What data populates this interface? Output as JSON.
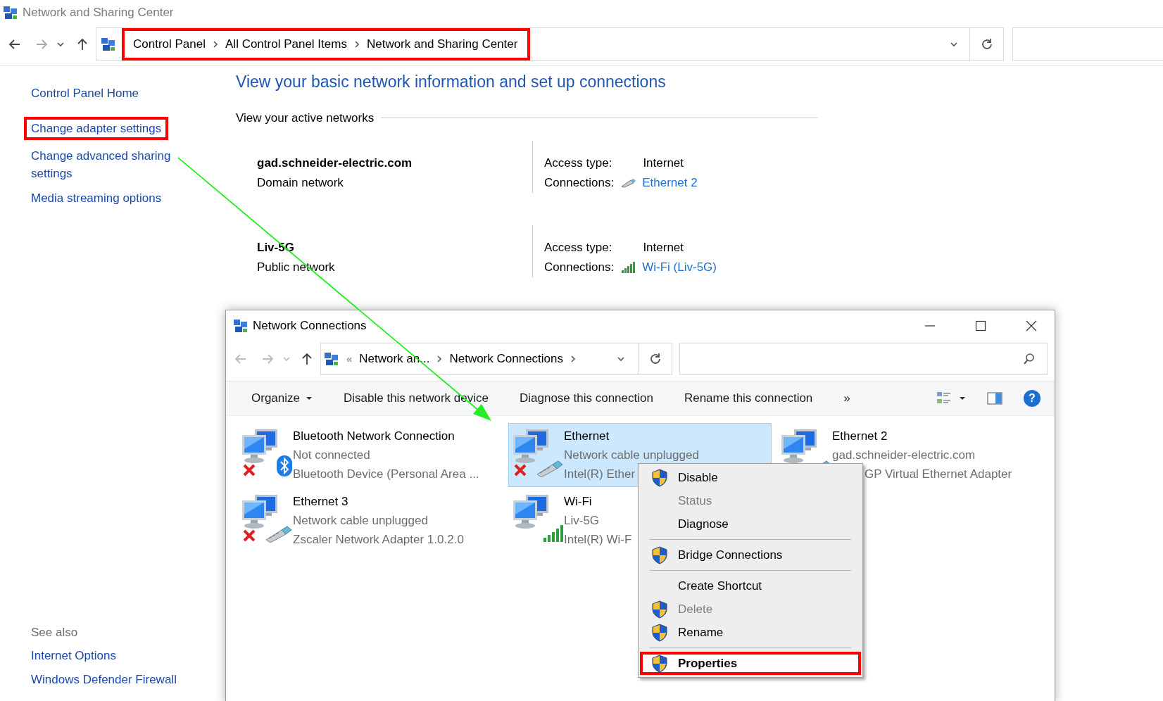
{
  "window": {
    "title": "Network and Sharing Center"
  },
  "address_bar": {
    "breadcrumbs": [
      "Control Panel",
      "All Control Panel Items",
      "Network and Sharing Center"
    ],
    "highlighted": true
  },
  "sidebar": {
    "links": [
      {
        "label": "Control Panel Home",
        "highlighted": false
      },
      {
        "label": "Change adapter settings",
        "highlighted": true
      },
      {
        "label": "Change advanced sharing settings",
        "highlighted": false
      },
      {
        "label": "Media streaming options",
        "highlighted": false
      }
    ],
    "see_also_heading": "See also",
    "see_also": [
      "Internet Options",
      "Windows Defender Firewall"
    ]
  },
  "main": {
    "heading": "View your basic network information and set up connections",
    "section_label": "View your active networks",
    "networks": [
      {
        "name": "gad.schneider-electric.com",
        "type": "Domain network",
        "access_label": "Access type:",
        "access": "Internet",
        "connections_label": "Connections:",
        "connection": "Ethernet 2",
        "kind": "ethernet"
      },
      {
        "name": "Liv-5G",
        "type": "Public network",
        "access_label": "Access type:",
        "access": "Internet",
        "connections_label": "Connections:",
        "connection": "Wi-Fi (Liv-5G)",
        "kind": "wifi"
      }
    ]
  },
  "connections_window": {
    "title": "Network Connections",
    "overflow_left": "«",
    "breadcrumbs": [
      "Network an...",
      "Network Connections"
    ],
    "toolbar": {
      "organize": "Organize",
      "commands": [
        "Disable this network device",
        "Diagnose this connection",
        "Rename this connection"
      ],
      "more": "»",
      "help": "?"
    },
    "adapters": [
      {
        "name": "Bluetooth Network Connection",
        "status": "Not connected",
        "device": "Bluetooth Device (Personal Area ...",
        "kind": "bluetooth",
        "connected": false,
        "selected": false
      },
      {
        "name": "Ethernet",
        "status": "Network cable unplugged",
        "device": "Intel(R) Ether",
        "kind": "ethernet",
        "connected": false,
        "selected": true
      },
      {
        "name": "Ethernet 2",
        "status": "gad.schneider-electric.com",
        "device": "GP Virtual Ethernet Adapter",
        "kind": "ethernet",
        "connected": true,
        "selected": false
      },
      {
        "name": "Ethernet 3",
        "status": "Network cable unplugged",
        "device": "Zscaler Network Adapter 1.0.2.0",
        "kind": "ethernet",
        "connected": false,
        "selected": false
      },
      {
        "name": "Wi-Fi",
        "status": "Liv-5G",
        "device": "Intel(R) Wi-F",
        "kind": "wifi",
        "connected": true,
        "selected": false
      }
    ],
    "context_menu": [
      {
        "kind": "item",
        "label": "Disable",
        "shield": true,
        "disabled": false,
        "default": false,
        "highlighted": false
      },
      {
        "kind": "item",
        "label": "Status",
        "shield": false,
        "disabled": true,
        "default": false,
        "highlighted": false
      },
      {
        "kind": "item",
        "label": "Diagnose",
        "shield": false,
        "disabled": false,
        "default": false,
        "highlighted": false
      },
      {
        "kind": "separator"
      },
      {
        "kind": "item",
        "label": "Bridge Connections",
        "shield": true,
        "disabled": false,
        "default": false,
        "highlighted": false
      },
      {
        "kind": "separator"
      },
      {
        "kind": "item",
        "label": "Create Shortcut",
        "shield": false,
        "disabled": false,
        "default": false,
        "highlighted": false
      },
      {
        "kind": "item",
        "label": "Delete",
        "shield": true,
        "disabled": true,
        "default": false,
        "highlighted": false
      },
      {
        "kind": "item",
        "label": "Rename",
        "shield": true,
        "disabled": false,
        "default": false,
        "highlighted": false
      },
      {
        "kind": "separator"
      },
      {
        "kind": "item",
        "label": "Properties",
        "shield": true,
        "disabled": false,
        "default": true,
        "highlighted": true
      }
    ]
  }
}
